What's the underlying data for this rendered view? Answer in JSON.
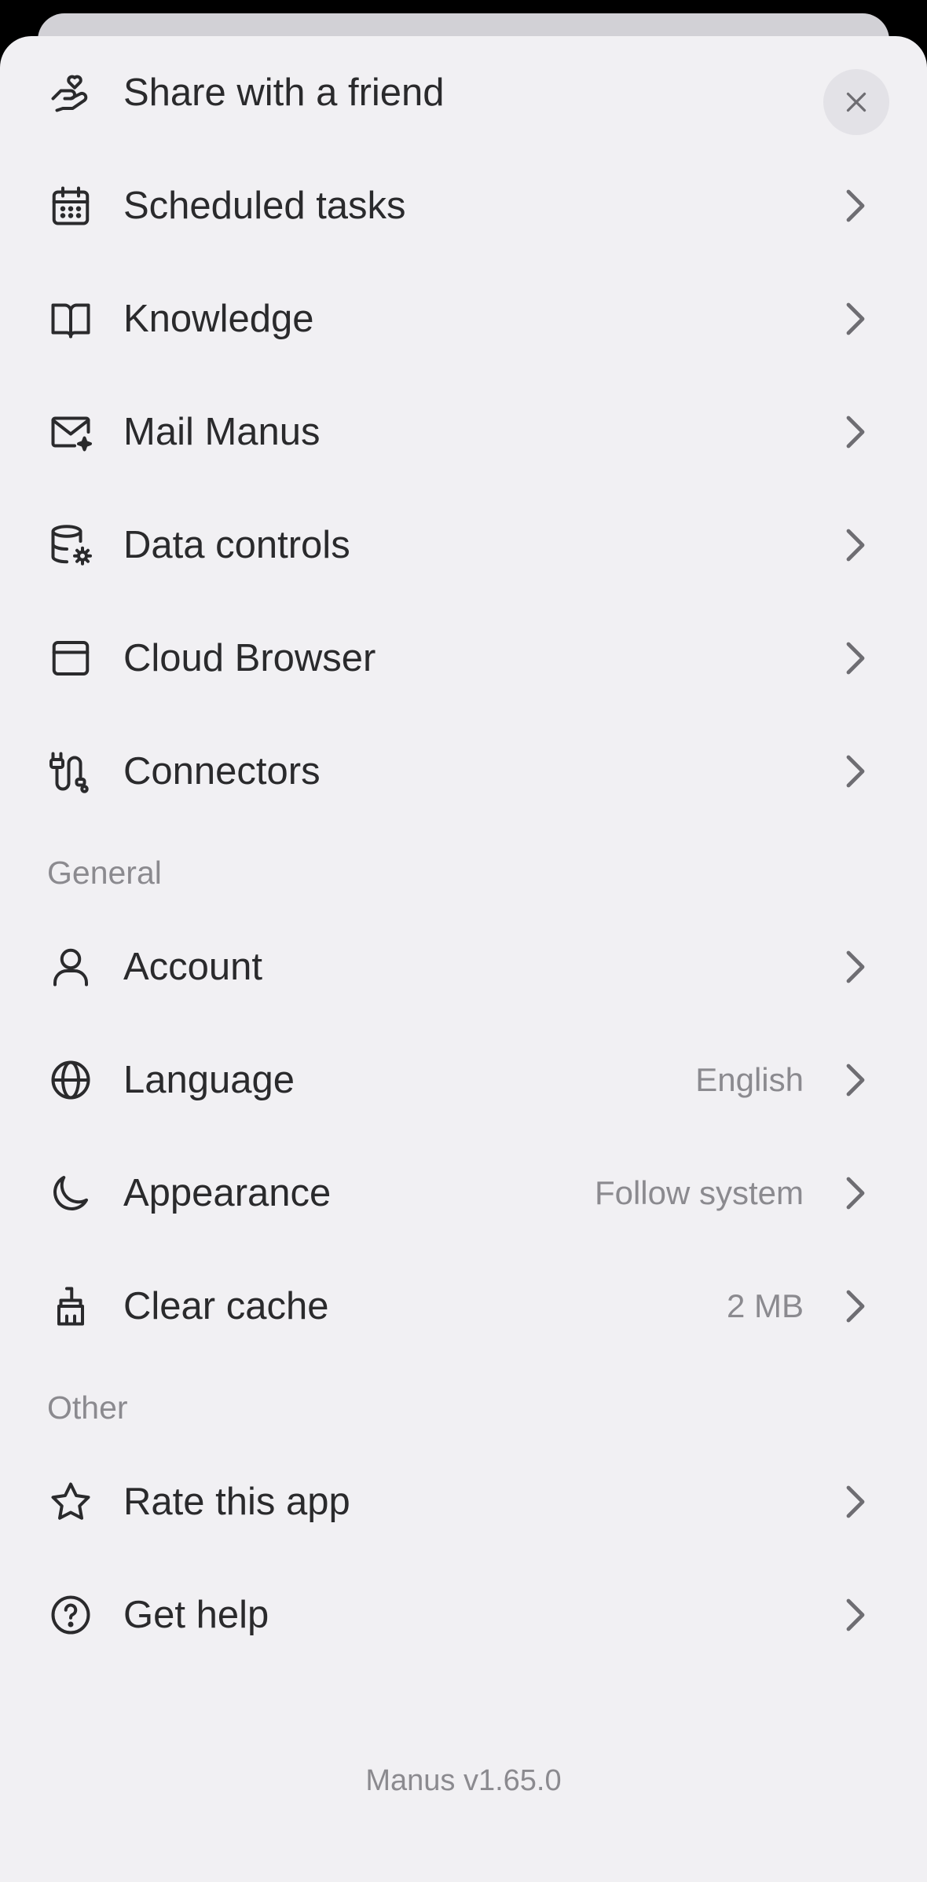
{
  "menu_items": [
    {
      "label": "Share with a friend",
      "icon": "hand-heart-icon"
    },
    {
      "label": "Scheduled tasks",
      "icon": "calendar-icon"
    },
    {
      "label": "Knowledge",
      "icon": "book-icon"
    },
    {
      "label": "Mail Manus",
      "icon": "mail-sparkle-icon"
    },
    {
      "label": "Data controls",
      "icon": "database-gear-icon"
    },
    {
      "label": "Cloud Browser",
      "icon": "browser-window-icon"
    },
    {
      "label": "Connectors",
      "icon": "plug-icon"
    }
  ],
  "general": {
    "title": "General",
    "items": [
      {
        "label": "Account",
        "value": "",
        "icon": "person-icon"
      },
      {
        "label": "Language",
        "value": "English",
        "icon": "globe-icon"
      },
      {
        "label": "Appearance",
        "value": "Follow system",
        "icon": "moon-icon"
      },
      {
        "label": "Clear cache",
        "value": "2 MB",
        "icon": "broom-icon"
      }
    ]
  },
  "other": {
    "title": "Other",
    "items": [
      {
        "label": "Rate this app",
        "icon": "star-icon"
      },
      {
        "label": "Get help",
        "icon": "help-circle-icon"
      }
    ]
  },
  "footer": {
    "version": "Manus v1.65.0"
  },
  "colors": {
    "background": "#f1f0f3",
    "text": "#2a2a2c",
    "secondary": "#8b8a8f"
  }
}
